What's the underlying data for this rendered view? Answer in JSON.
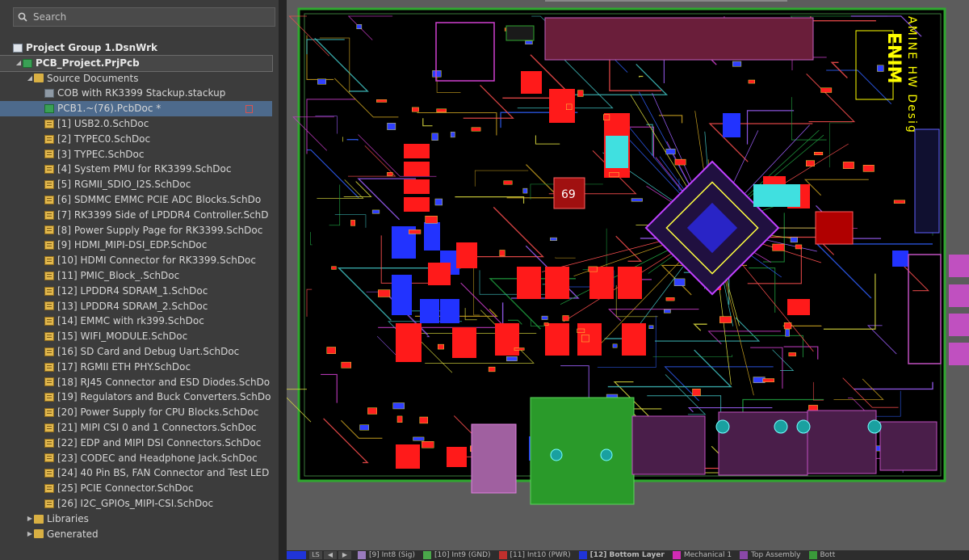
{
  "search": {
    "placeholder": "Search"
  },
  "tree": {
    "group": "Project Group 1.DsnWrk",
    "project": "PCB_Project.PrjPcb",
    "source_folder": "Source Documents",
    "stackup": "COB with RK3399 Stackup.stackup",
    "pcb": "PCB1.~(76).PcbDoc *",
    "schematics": [
      "[1] USB2.0.SchDoc",
      "[2] TYPEC0.SchDoc",
      "[3] TYPEC.SchDoc",
      "[4] System PMU for RK3399.SchDoc",
      "[5] RGMII_SDIO_I2S.SchDoc",
      "[6] SDMMC EMMC PCIE ADC Blocks.SchDo",
      "[7] RK3399 Side of LPDDR4 Controller.SchD",
      "[8] Power Supply Page for RK3399.SchDoc",
      "[9] HDMI_MIPI-DSI_EDP.SchDoc",
      "[10] HDMI Connector for RK3399.SchDoc",
      "[11] PMIC_Block_.SchDoc",
      "[12] LPDDR4 SDRAM_1.SchDoc",
      "[13] LPDDR4 SDRAM_2.SchDoc",
      "[14] EMMC with rk399.SchDoc",
      "[15] WIFI_MODULE.SchDoc",
      "[16] SD Card and Debug Uart.SchDoc",
      "[17] RGMII ETH PHY.SchDoc",
      "[18] RJ45 Connector and ESD Diodes.SchDo",
      "[19] Regulators and Buck Converters.SchDo",
      "[20] Power Supply for CPU Blocks.SchDoc",
      "[21] MIPI CSI 0 and 1 Connectors.SchDoc",
      "[22] EDP and MIPI DSI Connectors.SchDoc",
      "[23] CODEC and Headphone Jack.SchDoc",
      "[24] 40 Pin BS, FAN Connector and Test LED",
      "[25] PCIE Connector.SchDoc",
      "[26] I2C_GPIOs_MIPI-CSI.SchDoc"
    ],
    "libraries": "Libraries",
    "generated": "Generated"
  },
  "board": {
    "silk_text": "AMINE HW Desig",
    "logo_text": "ENIM",
    "chip_label": "69"
  },
  "layer_tabs": [
    {
      "label": "[9] Int8 (Sig)",
      "color": "#9a7bbd"
    },
    {
      "label": "[10] Int9 (GND)",
      "color": "#4aa84a"
    },
    {
      "label": "[11] Int10 (PWR)",
      "color": "#c0302d"
    },
    {
      "label": "[12] Bottom Layer",
      "color": "#2034d8"
    },
    {
      "label": "Mechanical 1",
      "color": "#d12bb5"
    },
    {
      "label": "Top Assembly",
      "color": "#8a48a8"
    },
    {
      "label": "Bott",
      "color": "#3a9a3a"
    }
  ],
  "colors": {
    "board_bg": "#000000",
    "board_outline": "#2fa82f",
    "top_copper": "#ff1a1a",
    "bottom_copper": "#2233ff",
    "silkscreen": "#ffff00",
    "selection": "#4d6a8c"
  }
}
